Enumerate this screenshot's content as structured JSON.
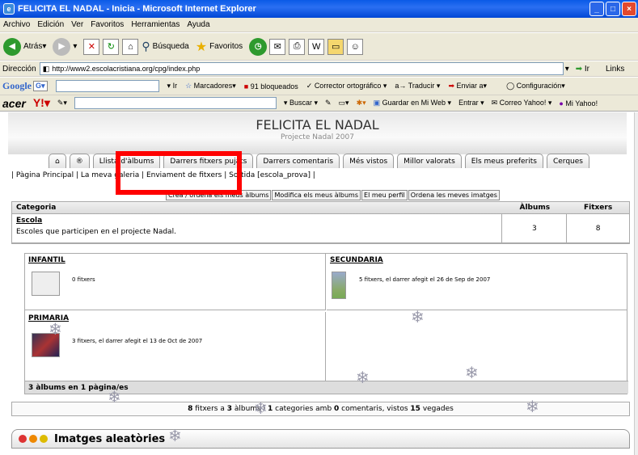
{
  "window": {
    "title": "FELICITA EL NADAL - Inicia - Microsoft Internet Explorer"
  },
  "menu": [
    "Archivo",
    "Edición",
    "Ver",
    "Favoritos",
    "Herramientas",
    "Ayuda"
  ],
  "toolbar": {
    "back": "Atrás",
    "search": "Búsqueda",
    "favorites": "Favoritos"
  },
  "address": {
    "label": "Dirección",
    "url": "http://www2.escolacristiana.org/cpg/index.php",
    "go": "Ir",
    "links": "Links"
  },
  "google": {
    "brand": "Google",
    "go": "Ir",
    "bookmarks": "Marcadores",
    "blocked": "91 bloqueados",
    "spell": "Corrector ortográfico",
    "translate": "Traducir",
    "send": "Enviar a",
    "config": "Configuración"
  },
  "acer": {
    "brand": "acer",
    "search": "Buscar",
    "save": "Guardar en Mi Web",
    "enter": "Entrar",
    "mail": "Correo Yahoo!",
    "my": "Mi Yahoo!"
  },
  "site": {
    "title": "FELICITA EL NADAL",
    "subtitle": "Projecte Nadal 2007"
  },
  "tabs": [
    "Llista d'àlbums",
    "Darrers fitxers pujats",
    "Darrers comentaris",
    "Més vistos",
    "Millor valorats",
    "Els meus preferits",
    "Cerques"
  ],
  "nav": "| Pàgina Principal | La meva galeria | Enviament de fitxers | Sortida [escola_prova] |",
  "subbuttons": [
    "Crea / ordena els meus àlbums",
    "Modifica els meus àlbums",
    "El meu perfil",
    "Ordena les meves imatges"
  ],
  "table": {
    "col_category": "Categoria",
    "col_albums": "Àlbums",
    "col_files": "Fitxers",
    "category_name": "Escola",
    "category_desc": "Escoles que participen en el projecte Nadal.",
    "albums_count": "3",
    "files_count": "8"
  },
  "albums": [
    {
      "title": "INFANTIL",
      "desc": "0 fitxers"
    },
    {
      "title": "SECUNDARIA",
      "desc": "5 fitxers, el darrer afegit el 26 de Sep de 2007"
    },
    {
      "title": "PRIMARIA",
      "desc": "3 fitxers, el darrer afegit el 13 de Oct de 2007"
    }
  ],
  "albums_footer": "3 àlbums en 1 pàgina/es",
  "stats": {
    "files": "8",
    "text1": "fitxers a",
    "albums": "3",
    "text2": "àlbums i",
    "categories": "1",
    "text3": "categories amb",
    "comments": "0",
    "text4": "comentaris, vistos",
    "views": "15",
    "text5": "vegades"
  },
  "random": {
    "title": "Imatges aleatòries"
  },
  "colors": {
    "xp_blue": "#0a5ae6",
    "red_box": "#ff0000"
  }
}
